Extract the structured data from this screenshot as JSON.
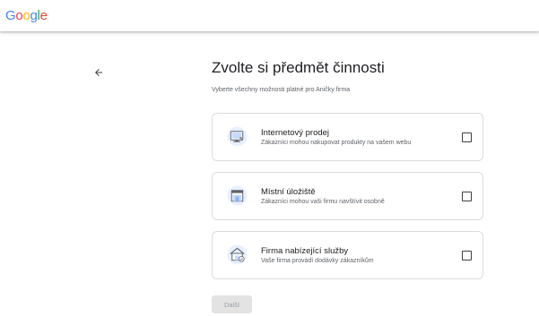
{
  "header": {
    "logo_parts": [
      "G",
      "o",
      "o",
      "g",
      "l",
      "e"
    ]
  },
  "page": {
    "title": "Zvolte si předmět činnosti",
    "subtitle": "Vyberte všechny možnosti platné pro Aničky firma"
  },
  "options": [
    {
      "title": "Internetový prodej",
      "description": "Zákazníci mohou nakupovat produkty na vašem webu",
      "icon": "online-store-icon",
      "checked": false
    },
    {
      "title": "Místní úložiště",
      "description": "Zákazníci mohou vaši firmu navštívit osobně",
      "icon": "storefront-icon",
      "checked": false
    },
    {
      "title": "Firma nabízející služby",
      "description": "Vaše firma provádí dodávky zákazníkům",
      "icon": "service-area-icon",
      "checked": false
    }
  ],
  "footer": {
    "next_label": "Další"
  },
  "colors": {
    "google_blue": "#4285f4",
    "google_red": "#ea4335",
    "google_yellow": "#fbbc05",
    "google_green": "#34a853",
    "icon_bg": "#e8f0fe",
    "button_disabled_bg": "#e3e3e3"
  }
}
